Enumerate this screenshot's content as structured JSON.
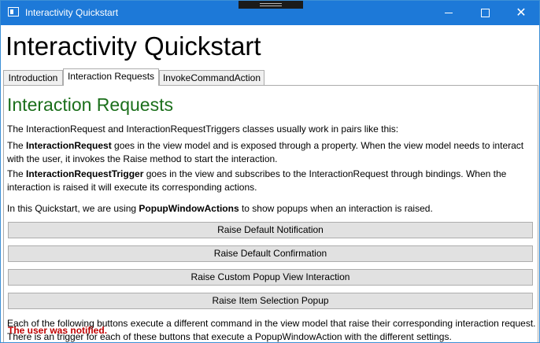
{
  "window": {
    "title": "Interactivity Quickstart"
  },
  "app": {
    "heading": "Interactivity Quickstart"
  },
  "tabs": [
    {
      "label": "Introduction"
    },
    {
      "label": "Interaction Requests"
    },
    {
      "label": "InvokeCommandAction"
    }
  ],
  "content": {
    "heading": "Interaction Requests",
    "intro": "The InteractionRequest and InteractionRequestTriggers classes usually work in pairs like this:",
    "p2": {
      "pre": "The ",
      "bold": "InteractionRequest",
      "post": " goes in the view model and is exposed through a property. When the view model needs to interact with the user, it invokes the Raise method to start the interaction."
    },
    "p3": {
      "pre": "The ",
      "bold": "InteractionRequestTrigger",
      "post": " goes in the view and subscribes to the InteractionRequest through bindings. When the interaction is raised it will execute its corresponding actions."
    },
    "p4": {
      "pre": "In this Quickstart, we are using ",
      "bold": "PopupWindowActions",
      "post": " to show popups when an interaction is raised."
    },
    "p5": "Each of the following buttons execute a different command in the view model that raise their corresponding interaction request. There is an trigger for each of these buttons that execute a PopupWindowAction with the different settings."
  },
  "buttons": {
    "notification": "Raise Default Notification",
    "confirmation": "Raise Default Confirmation",
    "custom_popup": "Raise Custom Popup View Interaction",
    "item_selection": "Raise Item Selection Popup"
  },
  "status": {
    "text": "The user was notified."
  },
  "colors": {
    "titlebar": "#1d79d8",
    "heading": "#1b6f1b",
    "status": "#c00000"
  }
}
